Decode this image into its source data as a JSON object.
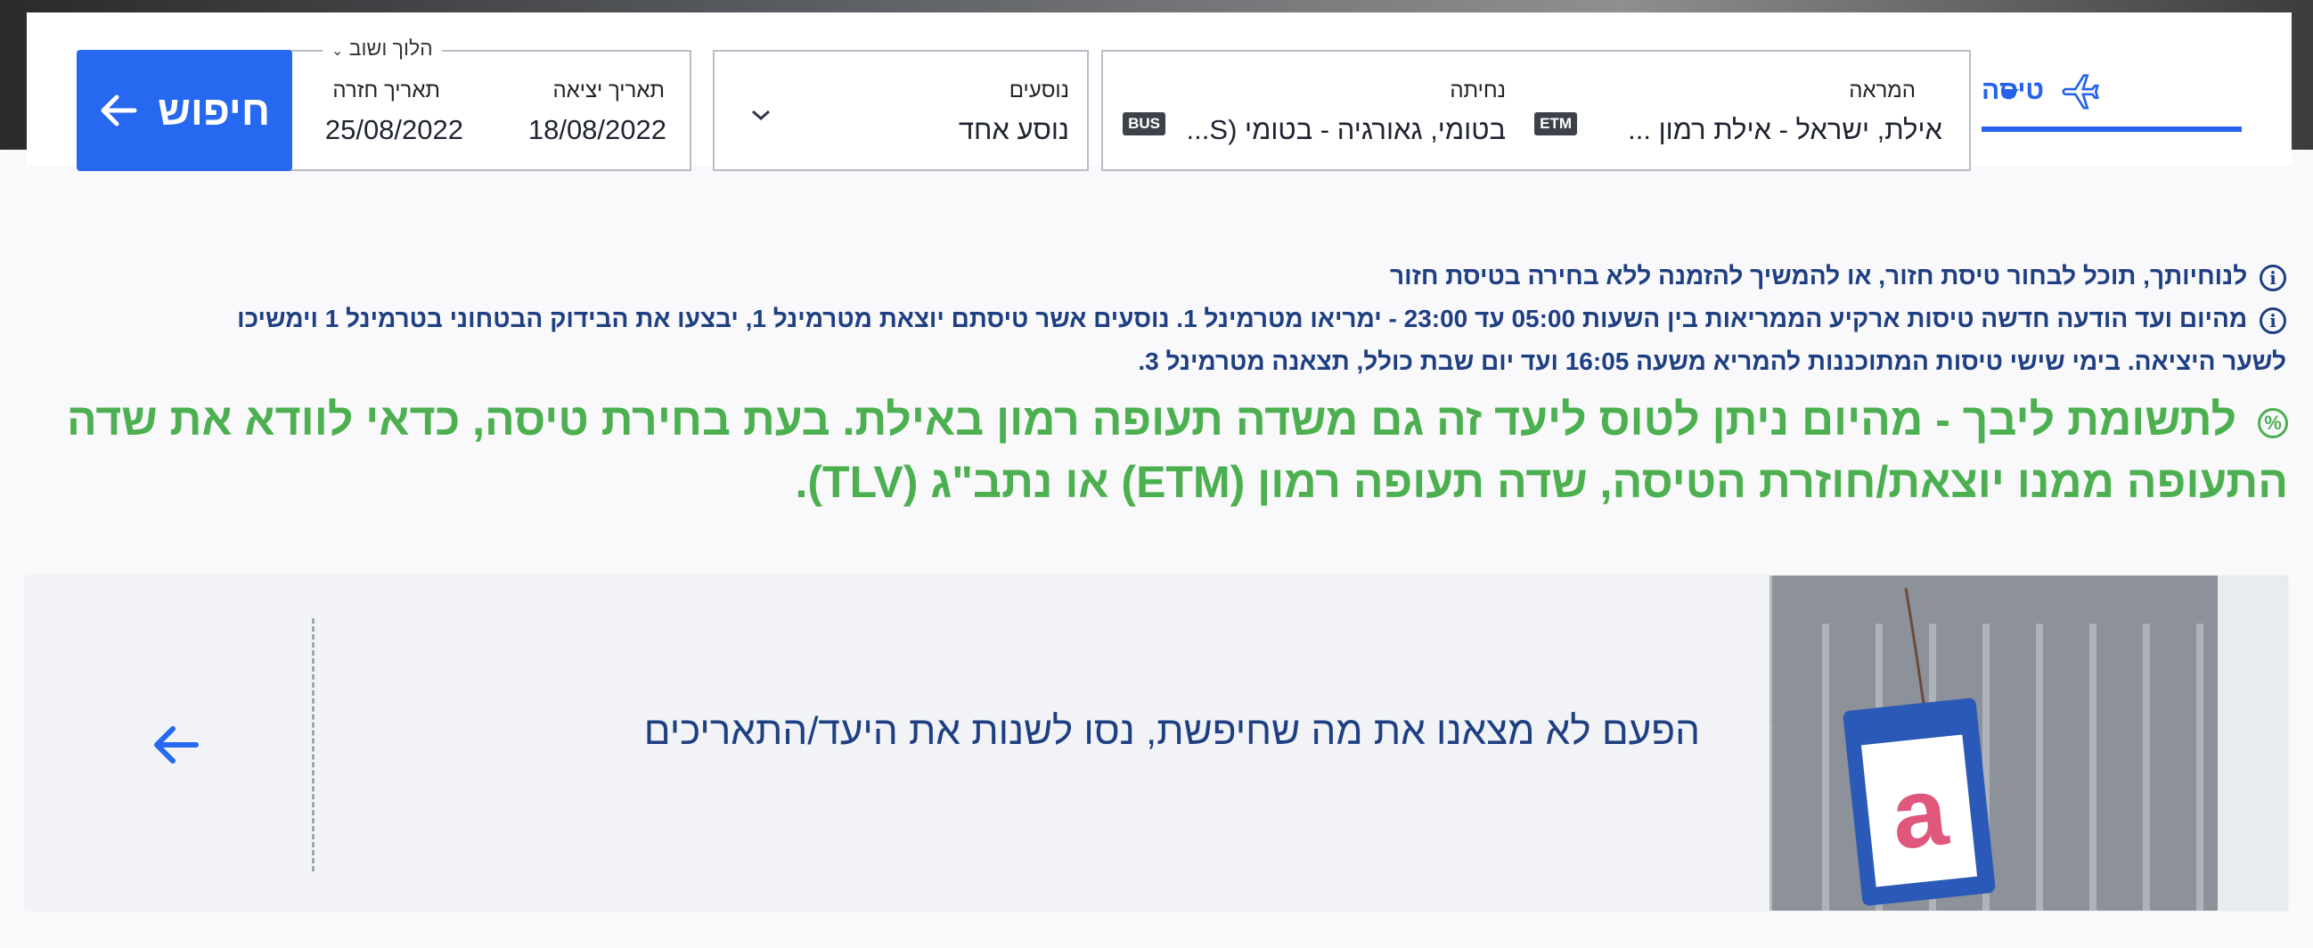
{
  "search": {
    "trip_type": "טיסה",
    "round_trip_label": "הלוך ושוב",
    "origin": {
      "label": "המראה",
      "value": "אילת, ישראל - אילת רמון ...",
      "code": "ETM"
    },
    "destination": {
      "label": "נחיתה",
      "value": "בטומי, גאורגיה - בטומי (S...",
      "code": "BUS"
    },
    "passengers": {
      "label": "נוסעים",
      "value": "נוסע אחד"
    },
    "departure": {
      "label": "תאריך יציאה",
      "value": "18/08/2022"
    },
    "return": {
      "label": "תאריך חזרה",
      "value": "25/08/2022"
    },
    "search_button": "חיפוש"
  },
  "notices": [
    "לנוחיותך, תוכל לבחור טיסת חזור, או להמשיך להזמנה ללא בחירה בטיסת חזור",
    "מהיום ועד הודעה חדשה טיסות ארקיע הממריאות בין השעות 05:00 עד 23:00 - ימריאו מטרמינל 1. נוסעים אשר טיסתם יוצאת מטרמינל 1, יבצעו את הבידוק הבטחוני בטרמינל 1 וימשיכו",
    "לשער היציאה. בימי שישי טיסות המתוכננות להמריא משעה 16:05 ועד יום שבת כולל, תצאנה מטרמינל 3."
  ],
  "promo": {
    "line1": "לתשומת ליבך - מהיום ניתן לטוס ליעד זה גם משדה תעופה רמון באילת. בעת בחירת טיסה, כדאי לוודא את שדה",
    "line2": "התעופה ממנו יוצאת/חוזרת הטיסה, שדה תעופה רמון (ETM) או נתב\"ג (TLV)."
  },
  "no_results": {
    "message": "הפעם לא מצאנו את מה שחיפשת, נסו לשנות את היעד/התאריכים"
  },
  "colors": {
    "accent": "#2668f0",
    "notice": "#1e3f82",
    "promo": "#4caf50"
  }
}
